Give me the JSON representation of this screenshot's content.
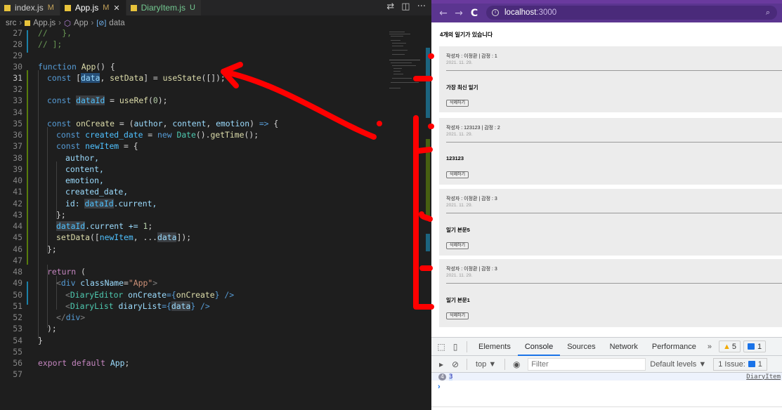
{
  "vscode": {
    "tabs": [
      {
        "label": "index.js",
        "status": "M",
        "active": false
      },
      {
        "label": "App.js",
        "status": "M",
        "active": true
      },
      {
        "label": "DiaryItem.js",
        "status": "U",
        "active": false
      }
    ],
    "close_glyph": "✕",
    "actions": {
      "compare": "compare-changes",
      "split": "split-editor",
      "more": "···"
    },
    "breadcrumb": [
      "src",
      "App.js",
      "App",
      "data"
    ],
    "lines": [
      {
        "n": "27"
      },
      {
        "n": "28"
      },
      {
        "n": "29"
      },
      {
        "n": "30"
      },
      {
        "n": "31"
      },
      {
        "n": "32"
      },
      {
        "n": "33"
      },
      {
        "n": "34"
      },
      {
        "n": "35"
      },
      {
        "n": "36"
      },
      {
        "n": "37"
      },
      {
        "n": "38"
      },
      {
        "n": "39"
      },
      {
        "n": "40"
      },
      {
        "n": "41"
      },
      {
        "n": "42"
      },
      {
        "n": "43"
      },
      {
        "n": "44"
      },
      {
        "n": "45"
      },
      {
        "n": "46"
      },
      {
        "n": "47"
      },
      {
        "n": "48"
      },
      {
        "n": "49"
      },
      {
        "n": "50"
      },
      {
        "n": "51"
      },
      {
        "n": "52"
      },
      {
        "n": "53"
      },
      {
        "n": "54"
      },
      {
        "n": "55"
      },
      {
        "n": "56"
      },
      {
        "n": "57"
      }
    ],
    "code": {
      "l27": "//   },",
      "l28": "// ];",
      "l30_kw": "function",
      "l30_fn": "App",
      "l30_rest": "() {",
      "l31_kw": "const",
      "l31_a": "[",
      "l31_data": "data",
      "l31_b": ", ",
      "l31_set": "setData",
      "l31_c": "] = ",
      "l31_fn": "useState",
      "l31_d": "([]);",
      "l33_kw": "const",
      "l33_var": "dataId",
      "l33_a": " = ",
      "l33_fn": "useRef",
      "l33_b": "(",
      "l33_num": "0",
      "l33_c": ");",
      "l35_kw": "const",
      "l35_fn": "onCreate",
      "l35_a": " = (",
      "l35_p1": "author",
      "l35_p2": "content",
      "l35_p3": "emotion",
      "l35_arrow": "=>",
      "l35_b": " {",
      "l36_kw": "const",
      "l36_var": "created_date",
      "l36_a": " = ",
      "l36_new": "new",
      "l36_cls": "Date",
      "l36_b": "().",
      "l36_fn": "getTime",
      "l36_c": "();",
      "l37_kw": "const",
      "l37_var": "newItem",
      "l37_a": " = {",
      "l38": "author,",
      "l39": "content,",
      "l40": "emotion,",
      "l41": "created_date,",
      "l42_a": "id: ",
      "l42_b": "dataId",
      "l42_c": ".current,",
      "l43": "};",
      "l44_a": "dataId",
      "l44_b": ".current += ",
      "l44_num": "1",
      "l44_c": ";",
      "l45_fn": "setData",
      "l45_a": "([",
      "l45_var": "newItem",
      "l45_b": ", ...",
      "l45_data": "data",
      "l45_c": "]);",
      "l46": "};",
      "l48_kw": "return",
      "l48_a": " (",
      "l49_a": "<",
      "l49_tag": "div",
      "l49_attr": "className",
      "l49_eq": "=",
      "l49_str": "\"App\"",
      "l49_b": ">",
      "l50_a": "<",
      "l50_comp": "DiaryEditor",
      "l50_attr": "onCreate",
      "l50_eq": "={",
      "l50_val": "onCreate",
      "l50_b": "} />",
      "l51_a": "<",
      "l51_comp": "DiaryList",
      "l51_attr": "diaryList",
      "l51_eq": "={",
      "l51_val": "data",
      "l51_b": "} />",
      "l52_a": "</",
      "l52_tag": "div",
      "l52_b": ">",
      "l53": ");",
      "l54": "}",
      "l56_kw1": "export",
      "l56_kw2": "default",
      "l56_name": "App",
      "l56_end": ";"
    }
  },
  "browser": {
    "back": "←",
    "forward": "→",
    "reload": "C",
    "url_host": "localhost",
    "url_port": ":3000",
    "zoom_icon": "zoom-icon",
    "page": {
      "count_text": "4개의 일기가 있습니다",
      "items": [
        {
          "info": "작성자 : 이정환 | 감정 : 1",
          "date": "2021. 11. 29.",
          "content": "가장 최신 일기",
          "delete_label": "삭제하기"
        },
        {
          "info": "작성자 : 123123 | 감정 : 2",
          "date": "2021. 11. 29.",
          "content": "123123",
          "delete_label": "삭제하기"
        },
        {
          "info": "작성자 : 이정환 | 감정 : 3",
          "date": "2021. 11. 29.",
          "content": "일기 본문5",
          "delete_label": "삭제하기"
        },
        {
          "info": "작성자 : 이정환 | 감정 : 3",
          "date": "2021. 11. 29.",
          "content": "일기 본문1",
          "delete_label": "삭제하기"
        }
      ]
    },
    "devtools": {
      "tabs": [
        "Elements",
        "Console",
        "Sources",
        "Network",
        "Performance"
      ],
      "active_tab": "Console",
      "more": "»",
      "warnings": "5",
      "messages": "1",
      "context": "top ▼",
      "filter_placeholder": "Filter",
      "levels": "Default levels ▼",
      "issues_label": "1 Issue:",
      "issues_count": "1",
      "log": {
        "count": "4",
        "value": "3",
        "source": "DiaryItem"
      },
      "prompt": "›"
    }
  },
  "annotation_color": "#ff0000"
}
